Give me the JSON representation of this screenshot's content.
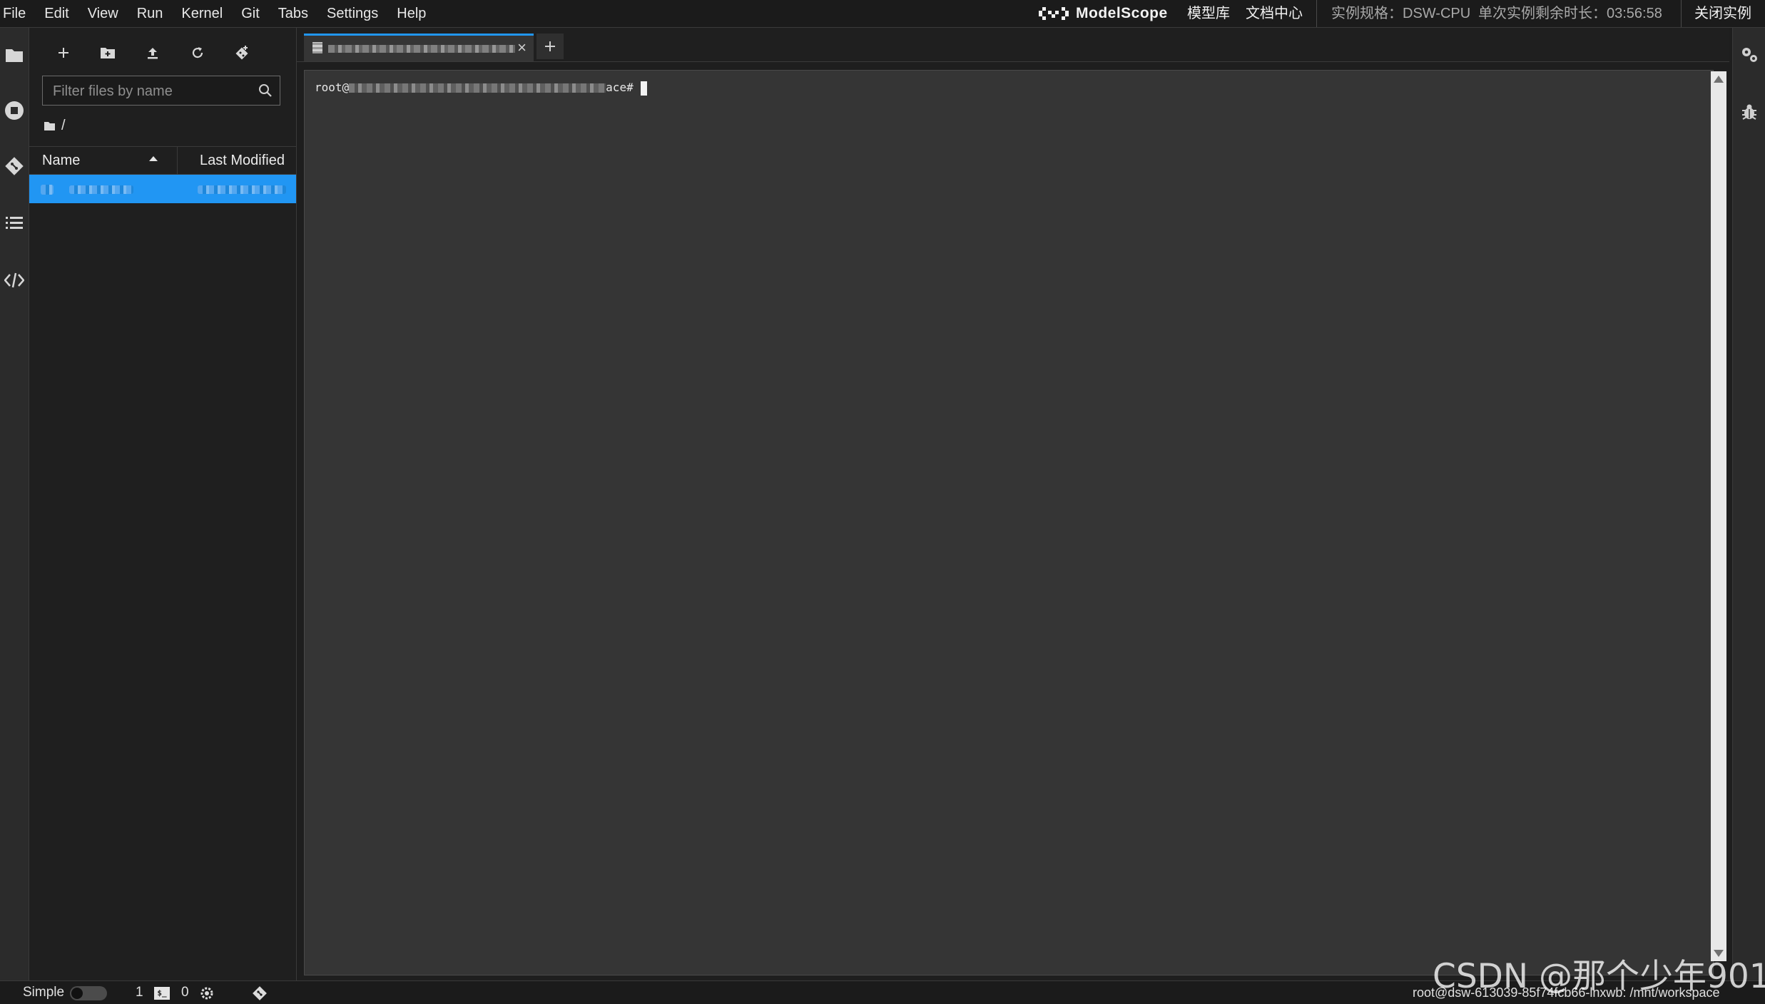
{
  "menubar": {
    "items": [
      "File",
      "Edit",
      "View",
      "Run",
      "Kernel",
      "Git",
      "Tabs",
      "Settings",
      "Help"
    ],
    "brand": "ModelScope",
    "model_hub": "模型库",
    "docs": "文档中心",
    "instance_spec": "实例规格：DSW-CPU",
    "remaining_time": "单次实例剩余时长：03:56:58",
    "close_instance": "关闭实例"
  },
  "activity_bar": {
    "icons": [
      "folder-icon",
      "stop-circle-icon",
      "git-icon",
      "table-of-contents-icon",
      "code-icon"
    ]
  },
  "file_browser": {
    "toolbar_icons": [
      "new-launcher-icon",
      "new-folder-icon",
      "upload-icon",
      "refresh-icon",
      "git-clone-icon"
    ],
    "search_placeholder": "Filter files by name",
    "breadcrumb": "/",
    "columns": {
      "name": "Name",
      "modified": "Last Modified"
    }
  },
  "terminal": {
    "prompt_prefix": "root@",
    "prompt_suffix": "ace#"
  },
  "right_bar": {
    "icons": [
      "property-inspector-icon",
      "debugger-icon"
    ]
  },
  "statusbar": {
    "mode_label": "Simple",
    "terminals_count": "1",
    "kernels_count": "0",
    "path": "root@dsw-613039-85f74fcb66-lnxwb: /mnt/workspace"
  },
  "watermark": "CSDN @那个少年901",
  "colors": {
    "accent": "#2196f3",
    "background": "#1e1e1e",
    "terminal_bg": "#353535"
  }
}
